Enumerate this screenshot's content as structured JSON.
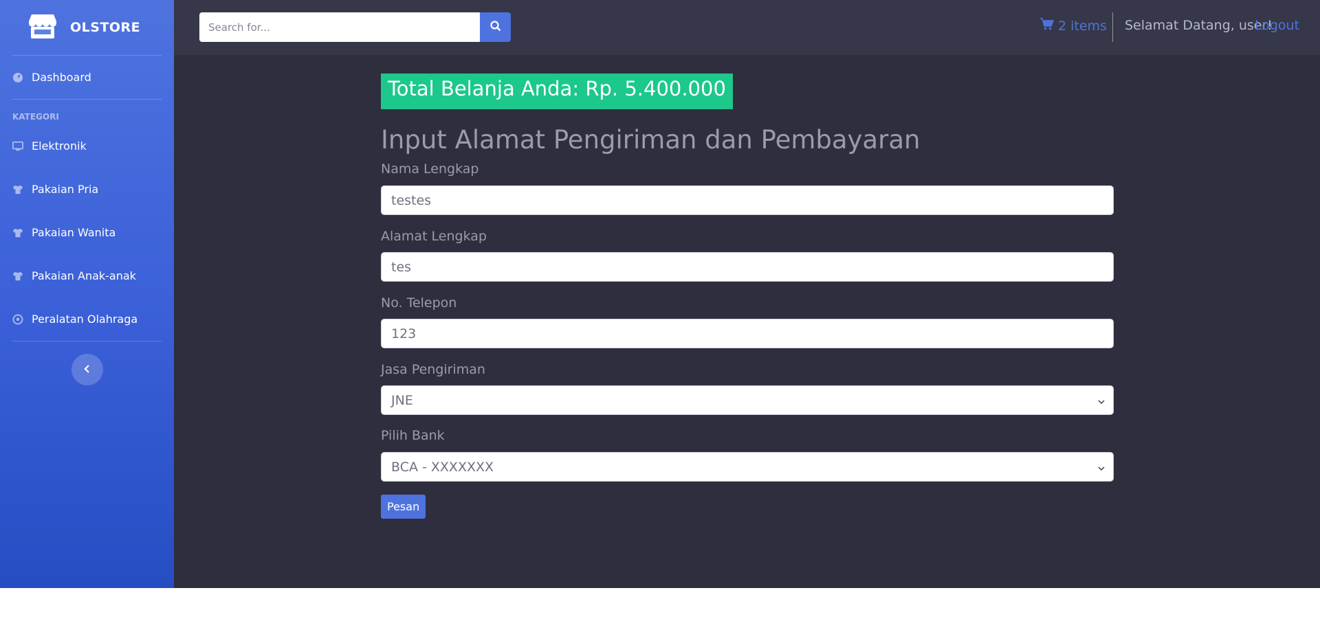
{
  "brand": {
    "name": "OLSTORE",
    "icon": "store-icon"
  },
  "sidebar": {
    "dashboard": {
      "label": "Dashboard",
      "icon": "dashboard-icon"
    },
    "heading": "KATEGORI",
    "items": [
      {
        "label": "Elektronik",
        "icon": "desktop-icon"
      },
      {
        "label": "Pakaian Pria",
        "icon": "tshirt-icon"
      },
      {
        "label": "Pakaian Wanita",
        "icon": "tshirt-icon"
      },
      {
        "label": "Pakaian Anak-anak",
        "icon": "tshirt-icon"
      },
      {
        "label": "Peralatan Olahraga",
        "icon": "football-icon"
      }
    ],
    "toggle_icon": "chevron-left-icon"
  },
  "topbar": {
    "search_placeholder": "Search for...",
    "cart_label": "2 items",
    "welcome": "Selamat Datang, user!",
    "logout": "Logout"
  },
  "main": {
    "total_label": "Total Belanja Anda: Rp. 5.400.000",
    "title": "Input Alamat Pengiriman dan Pembayaran",
    "fields": {
      "nama": {
        "label": "Nama Lengkap",
        "value": "testes"
      },
      "alamat": {
        "label": "Alamat Lengkap",
        "value": "tes"
      },
      "telepon": {
        "label": "No. Telepon",
        "value": "123"
      },
      "jasa": {
        "label": "Jasa Pengiriman",
        "value": "JNE"
      },
      "bank": {
        "label": "Pilih Bank",
        "value": "BCA - XXXXXXX"
      }
    },
    "submit_label": "Pesan"
  },
  "colors": {
    "primary": "#4e73df",
    "success": "#1cc88a",
    "content_bg": "#2f2e3f",
    "topbar_bg": "#363748"
  }
}
